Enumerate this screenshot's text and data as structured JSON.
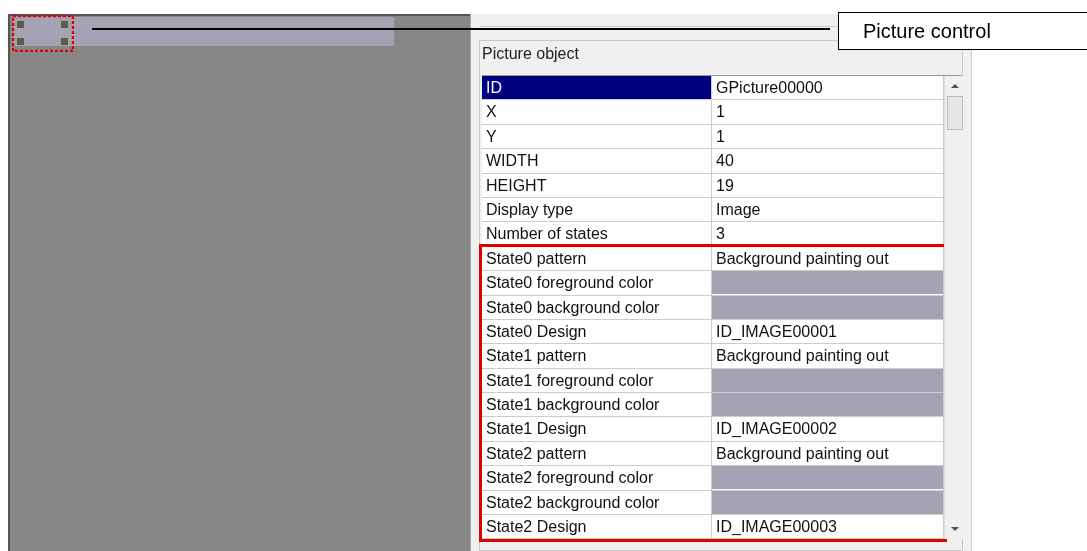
{
  "callout": {
    "label": "Picture control"
  },
  "properties": {
    "title": "Picture object",
    "rows": [
      {
        "name": "ID",
        "kind": "text",
        "value": "GPicture00000",
        "selected": true
      },
      {
        "name": "X",
        "kind": "text",
        "value": "1",
        "selected": false
      },
      {
        "name": "Y",
        "kind": "text",
        "value": "1",
        "selected": false
      },
      {
        "name": "WIDTH",
        "kind": "text",
        "value": "40",
        "selected": false
      },
      {
        "name": "HEIGHT",
        "kind": "text",
        "value": "19",
        "selected": false
      },
      {
        "name": "Display type",
        "kind": "text",
        "value": "Image",
        "selected": false
      },
      {
        "name": "Number of states",
        "kind": "text",
        "value": "3",
        "selected": false
      }
    ],
    "highlighted_rows": [
      {
        "name": "State0 pattern",
        "kind": "text",
        "value": "Background painting out",
        "selected": false
      },
      {
        "name": "State0 foreground color",
        "kind": "color",
        "color": "#a4a3b4",
        "selected": false
      },
      {
        "name": "State0 background color",
        "kind": "color",
        "color": "#a4a3b4",
        "selected": false
      },
      {
        "name": "State0 Design",
        "kind": "text",
        "value": "ID_IMAGE00001",
        "selected": false
      },
      {
        "name": "State1 pattern",
        "kind": "text",
        "value": "Background painting out",
        "selected": false
      },
      {
        "name": "State1 foreground color",
        "kind": "color",
        "color": "#a4a3b4",
        "selected": false
      },
      {
        "name": "State1 background color",
        "kind": "color",
        "color": "#a4a3b4",
        "selected": false
      },
      {
        "name": "State1 Design",
        "kind": "text",
        "value": "ID_IMAGE00002",
        "selected": false
      },
      {
        "name": "State2 pattern",
        "kind": "text",
        "value": "Background painting out",
        "selected": false
      },
      {
        "name": "State2 foreground color",
        "kind": "color",
        "color": "#a4a3b4",
        "selected": false
      },
      {
        "name": "State2 background color",
        "kind": "color",
        "color": "#a4a3b4",
        "selected": false
      },
      {
        "name": "State2 Design",
        "kind": "text",
        "value": "ID_IMAGE00003",
        "selected": false
      }
    ]
  }
}
